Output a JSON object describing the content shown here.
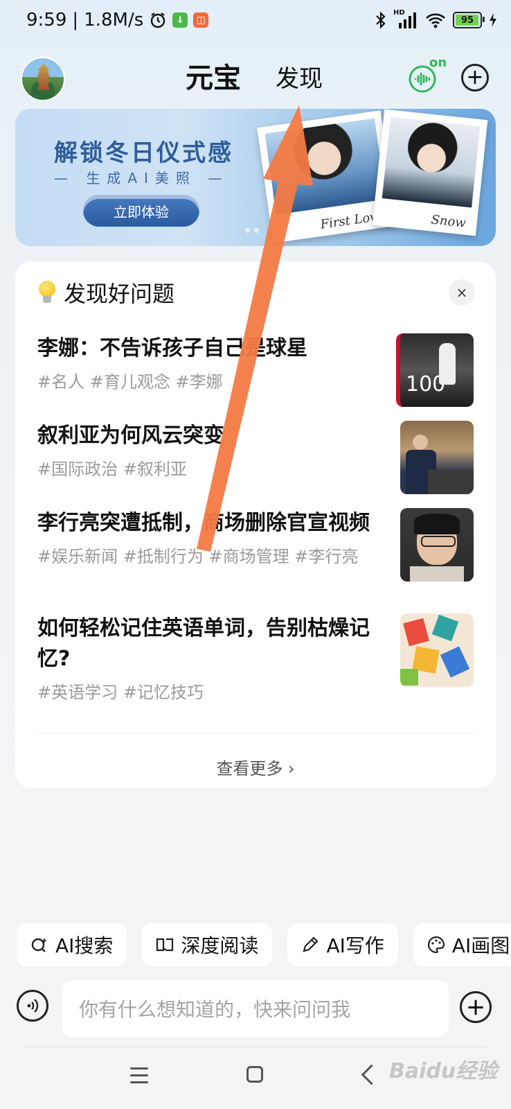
{
  "status_bar": {
    "time": "9:59",
    "net_speed": "1.8M/s",
    "battery": "95",
    "hd_label": "HD"
  },
  "header": {
    "tab_active": "元宝",
    "tab_discover": "发现",
    "voice_on_label": "on"
  },
  "banner": {
    "title": "解锁冬日仪式感",
    "subtitle": "— 生成AI美照 —",
    "button": "立即体验",
    "caption_left": "First Love",
    "caption_right": "Snow"
  },
  "questions_card": {
    "title": "发现好问题",
    "close": "×",
    "items": [
      {
        "title": "李娜：不告诉孩子自己是球星",
        "tags": "#名人 #育儿观念 #李娜"
      },
      {
        "title": "叙利亚为何风云突变",
        "tags": "#国际政治 #叙利亚"
      },
      {
        "title": "李行亮突遭抵制，商场删除官宣视频",
        "tags": "#娱乐新闻 #抵制行为 #商场管理 #李行亮"
      },
      {
        "title": "如何轻松记住英语单词，告别枯燥记忆?",
        "tags": "#英语学习 #记忆技巧"
      }
    ],
    "thumb1_text": "100",
    "see_more": "查看更多 ›"
  },
  "chips": [
    {
      "label": "AI搜索",
      "icon": "search-spark-icon"
    },
    {
      "label": "深度阅读",
      "icon": "book-icon"
    },
    {
      "label": "AI写作",
      "icon": "pen-icon"
    },
    {
      "label": "AI画图",
      "icon": "palette-icon"
    }
  ],
  "input": {
    "placeholder": "你有什么想知道的，快来问问我"
  },
  "watermark": "Baidu经验",
  "colors": {
    "accent_green": "#2fb85a",
    "annotation_arrow": "#f47a45",
    "banner_blue": "#2f5d9c"
  }
}
